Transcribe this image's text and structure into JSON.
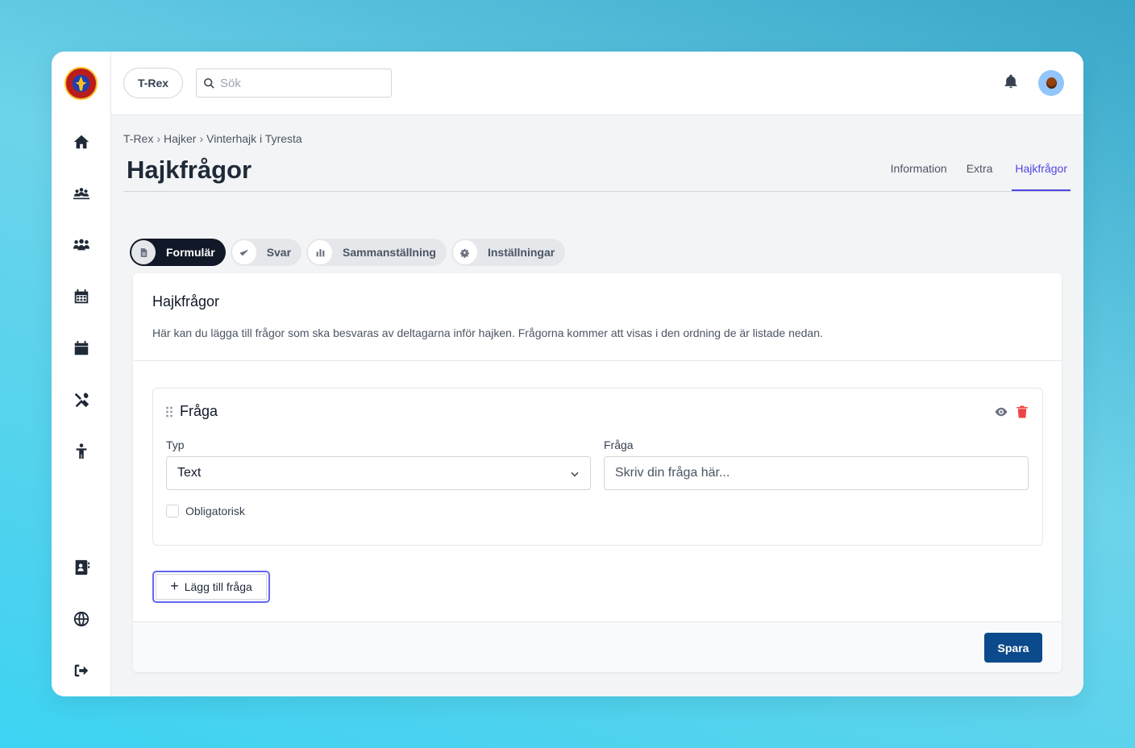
{
  "topbar": {
    "org": "T-Rex",
    "search_placeholder": "Sök"
  },
  "sidebar": {
    "items": [
      {
        "name": "home-icon"
      },
      {
        "name": "group-icon"
      },
      {
        "name": "users-icon"
      },
      {
        "name": "calendar-grid-icon"
      },
      {
        "name": "calendar-icon"
      },
      {
        "name": "tools-icon"
      },
      {
        "name": "child-icon"
      },
      {
        "name": "contact-book-icon"
      },
      {
        "name": "globe-icon"
      },
      {
        "name": "logout-icon"
      }
    ]
  },
  "breadcrumb": [
    "T-Rex",
    "Hajker",
    "Vinterhajk i Tyresta"
  ],
  "page": {
    "title": "Hajkfrågor",
    "tabs": [
      "Information",
      "Extra",
      "Hajkfrågor"
    ],
    "active_tab": "Hajkfrågor"
  },
  "subtabs": [
    {
      "label": "Formulär",
      "icon": "document-icon",
      "active": true
    },
    {
      "label": "Svar",
      "icon": "check-icon",
      "active": false
    },
    {
      "label": "Sammanställning",
      "icon": "bar-chart-icon",
      "active": false
    },
    {
      "label": "Inställningar",
      "icon": "gear-icon",
      "active": false
    }
  ],
  "card": {
    "title": "Hajkfrågor",
    "description": "Här kan du lägga till frågor som ska besvaras av deltagarna inför hajken. Frågorna kommer att visas i den ordning de är listade nedan.",
    "question": {
      "title": "Fråga",
      "type_label": "Typ",
      "type_value": "Text",
      "question_label": "Fråga",
      "question_placeholder": "Skriv din fråga här...",
      "required_label": "Obligatorisk"
    },
    "add_button": "Lägg till fråga",
    "save_button": "Spara"
  },
  "colors": {
    "accent": "#4f46e5",
    "primary_button": "#0b4a8b",
    "delete": "#ef4444"
  }
}
